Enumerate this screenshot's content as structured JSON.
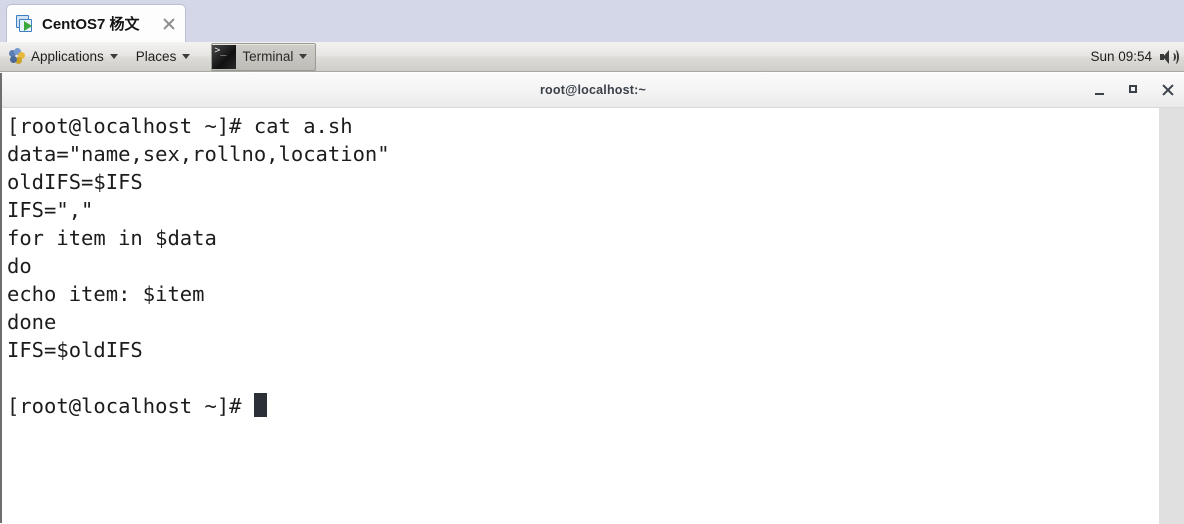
{
  "vm_client": {
    "tab": {
      "title": "CentOS7 杨文",
      "icon": "virtual-machine-icon",
      "close_label": "×"
    }
  },
  "gnome_panel": {
    "applications_label": "Applications",
    "places_label": "Places",
    "window_label": "Terminal",
    "clock": "Sun 09:54",
    "volume_icon": "volume-speaker-icon"
  },
  "terminal": {
    "title": "root@localhost:~",
    "window_buttons": {
      "minimize": "minimize-button",
      "maximize": "maximize-button",
      "close": "close-button"
    },
    "lines": [
      "[root@localhost ~]# cat a.sh",
      "data=\"name,sex,rollno,location\"",
      "oldIFS=$IFS",
      "IFS=\",\"",
      "for item in $data",
      "do",
      "echo item: $item",
      "done",
      "IFS=$oldIFS",
      "",
      "[root@localhost ~]# "
    ],
    "prompt_line_index": 10,
    "cursor": "block"
  },
  "colors": {
    "tabstrip_bg": "#d3d7e8",
    "panel_bg": "#e6e5e2",
    "terminal_bg": "#ffffff",
    "terminal_fg": "#1c1c1c",
    "cursor": "#2b3136",
    "scrollbar": "#e0e0e0"
  }
}
